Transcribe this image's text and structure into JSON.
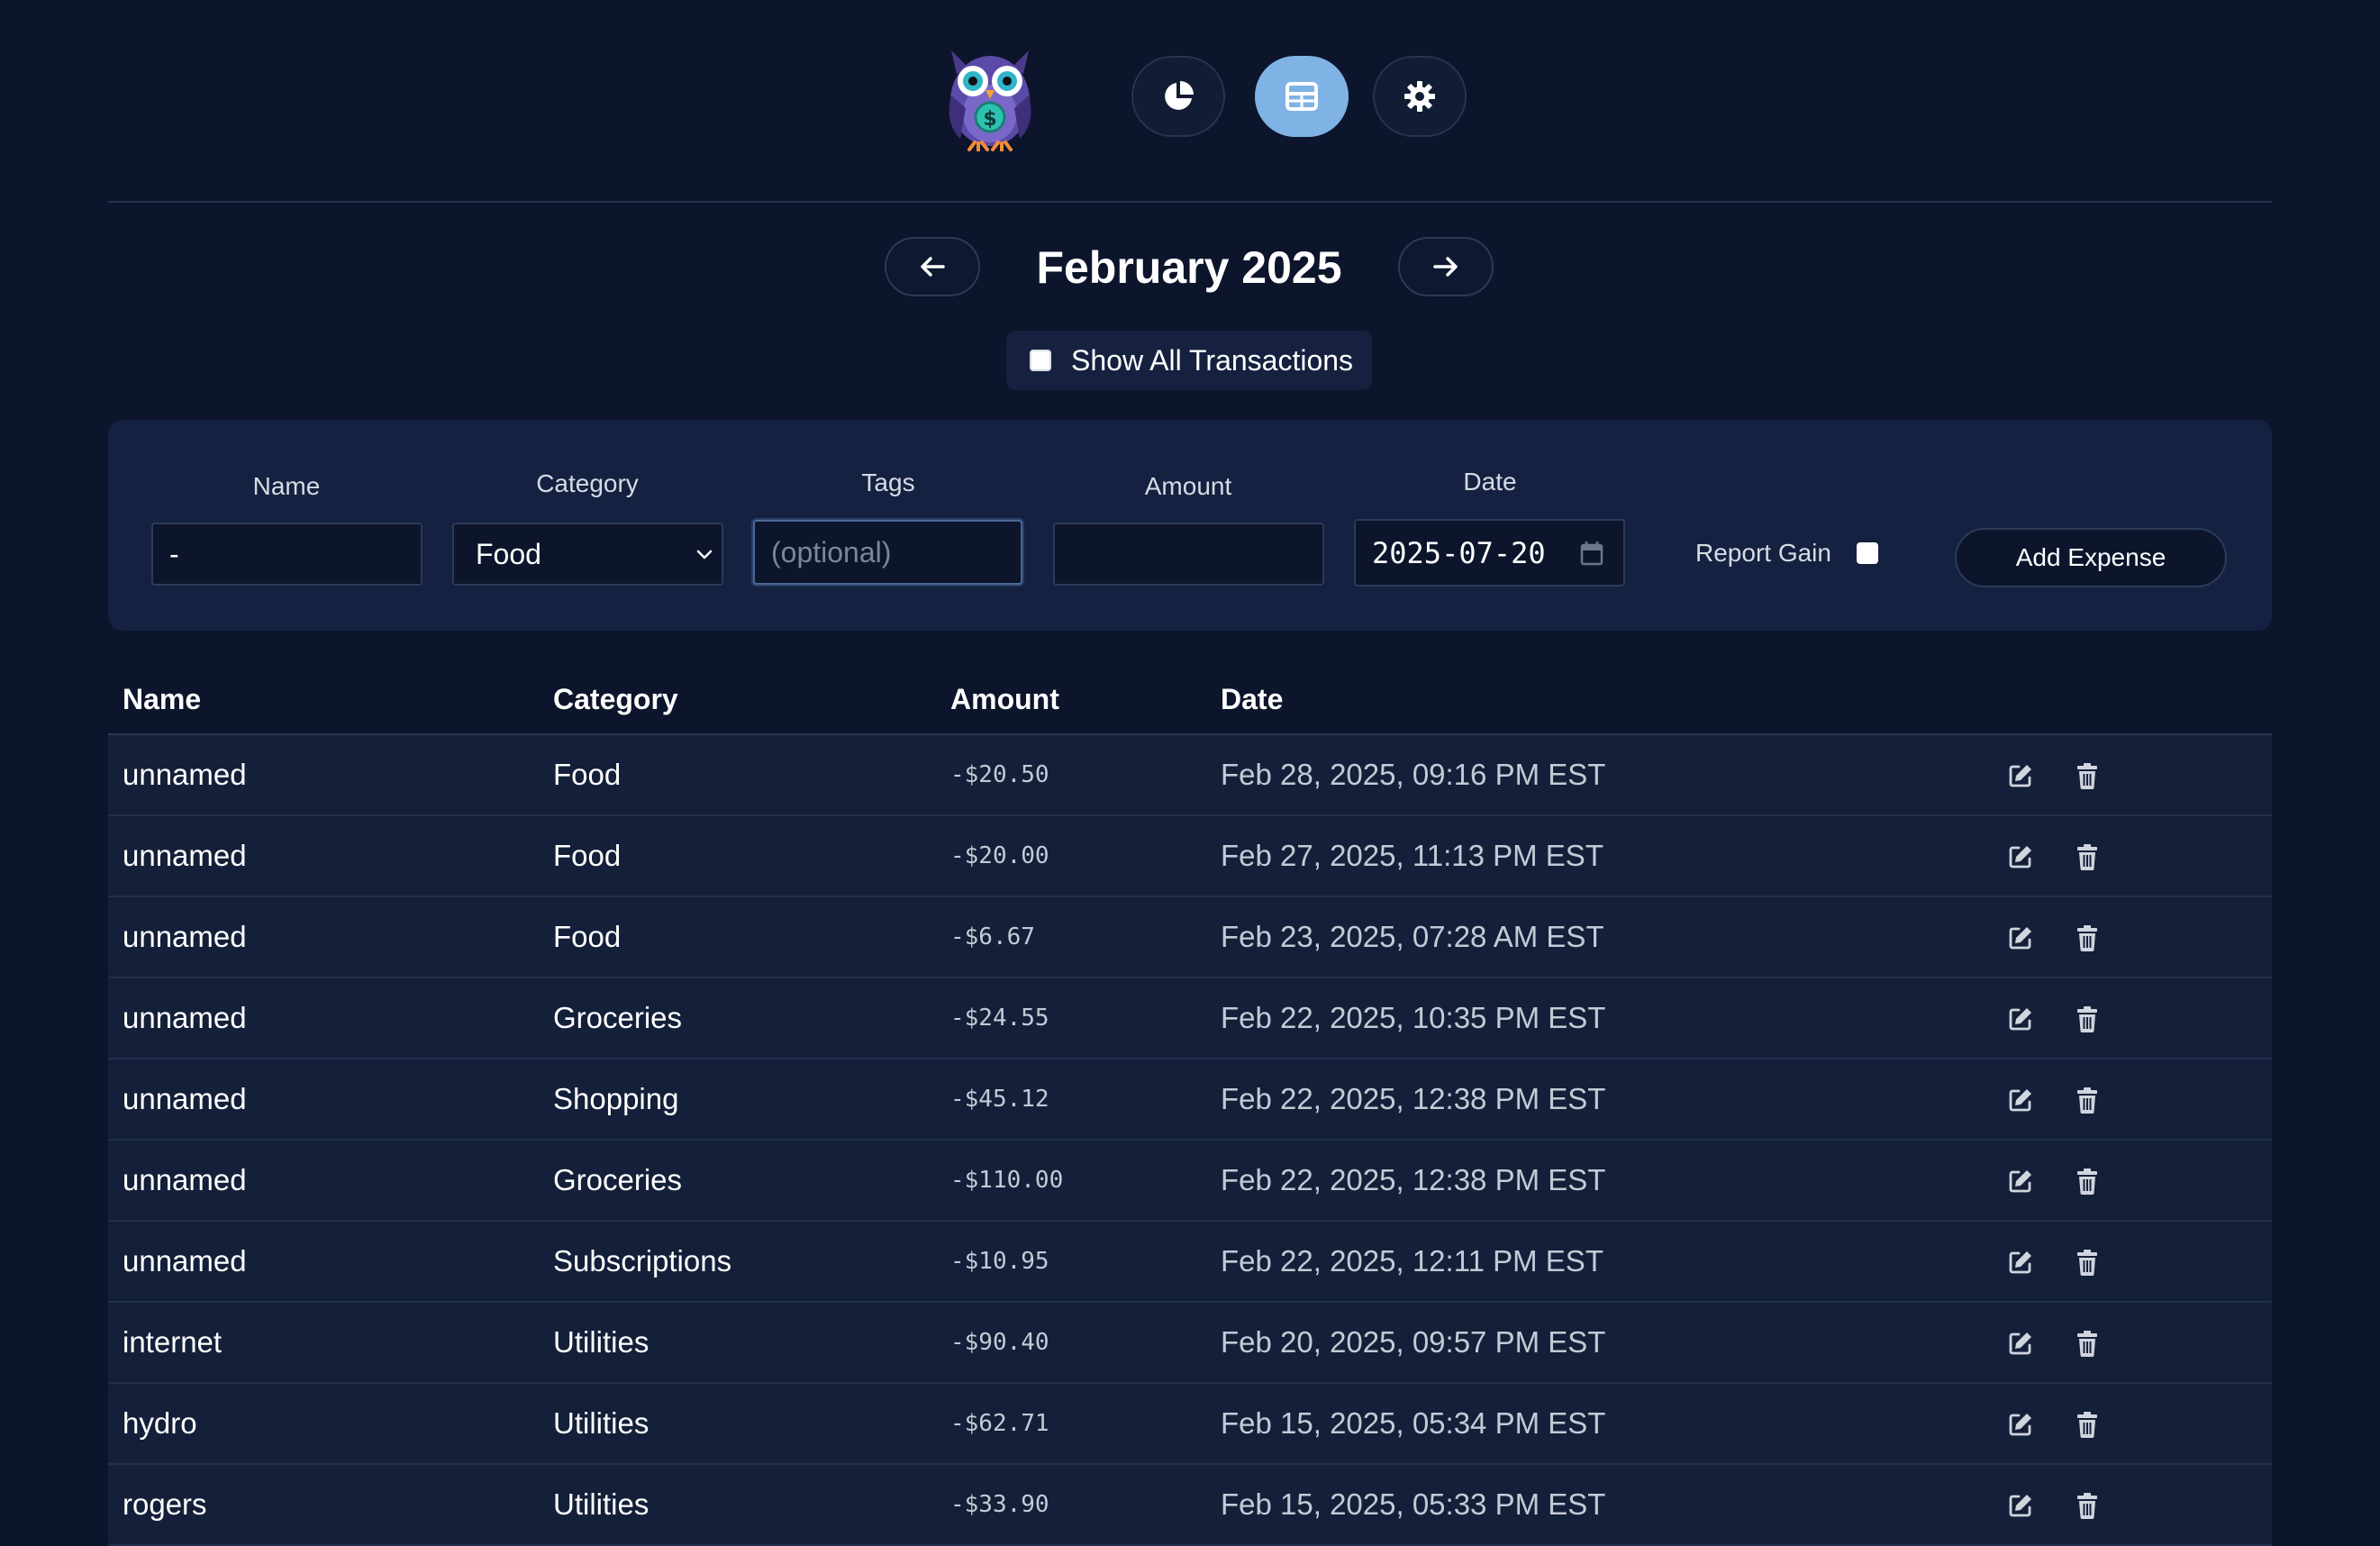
{
  "nav": {
    "logo": "owl-mascot-logo",
    "buttons": [
      {
        "name": "charts",
        "icon": "pie-chart-icon",
        "active": false
      },
      {
        "name": "table",
        "icon": "table-icon",
        "active": true
      },
      {
        "name": "settings",
        "icon": "gear-icon",
        "active": false
      }
    ]
  },
  "month": {
    "title": "February 2025",
    "prev_icon": "arrow-left-icon",
    "next_icon": "arrow-right-icon"
  },
  "show_all": {
    "label": "Show All Transactions",
    "checked": false
  },
  "form": {
    "name_label": "Name",
    "name_value": "-",
    "category_label": "Category",
    "category_value": "Food",
    "tags_label": "Tags",
    "tags_placeholder": "(optional)",
    "amount_label": "Amount",
    "amount_value": "",
    "date_label": "Date",
    "date_value": "2025-07-20",
    "report_gain_label": "Report Gain",
    "report_gain_checked": false,
    "add_button": "Add Expense"
  },
  "table": {
    "headers": {
      "name": "Name",
      "category": "Category",
      "amount": "Amount",
      "date": "Date"
    },
    "rows": [
      {
        "name": "unnamed",
        "category": "Food",
        "amount": "-$20.50",
        "date": "Feb 28, 2025, 09:16 PM EST"
      },
      {
        "name": "unnamed",
        "category": "Food",
        "amount": "-$20.00",
        "date": "Feb 27, 2025, 11:13 PM EST"
      },
      {
        "name": "unnamed",
        "category": "Food",
        "amount": "-$6.67",
        "date": "Feb 23, 2025, 07:28 AM EST"
      },
      {
        "name": "unnamed",
        "category": "Groceries",
        "amount": "-$24.55",
        "date": "Feb 22, 2025, 10:35 PM EST"
      },
      {
        "name": "unnamed",
        "category": "Shopping",
        "amount": "-$45.12",
        "date": "Feb 22, 2025, 12:38 PM EST"
      },
      {
        "name": "unnamed",
        "category": "Groceries",
        "amount": "-$110.00",
        "date": "Feb 22, 2025, 12:38 PM EST"
      },
      {
        "name": "unnamed",
        "category": "Subscriptions",
        "amount": "-$10.95",
        "date": "Feb 22, 2025, 12:11 PM EST"
      },
      {
        "name": "internet",
        "category": "Utilities",
        "amount": "-$90.40",
        "date": "Feb 20, 2025, 09:57 PM EST"
      },
      {
        "name": "hydro",
        "category": "Utilities",
        "amount": "-$62.71",
        "date": "Feb 15, 2025, 05:34 PM EST"
      },
      {
        "name": "rogers",
        "category": "Utilities",
        "amount": "-$33.90",
        "date": "Feb 15, 2025, 05:33 PM EST"
      }
    ],
    "row_actions": [
      "edit-icon",
      "trash-icon"
    ]
  },
  "colors": {
    "background": "#0c152b",
    "panel": "#152140",
    "row": "#142039",
    "accent": "#7fb3e6",
    "border": "#2c3b58"
  }
}
